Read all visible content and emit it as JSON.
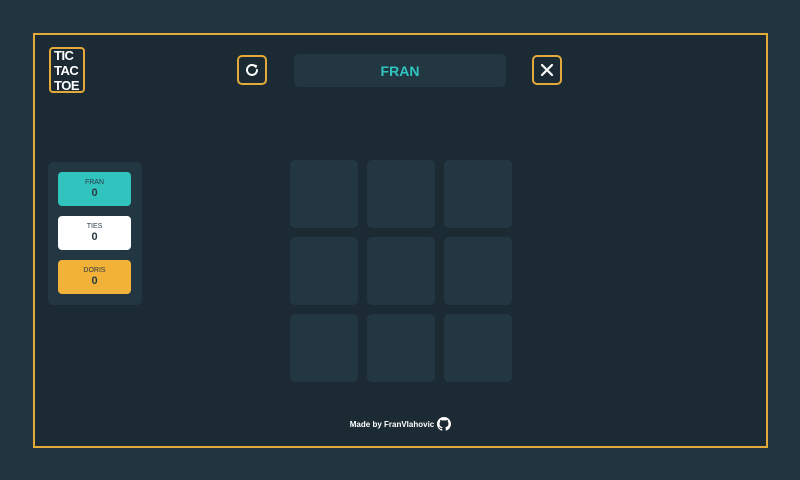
{
  "logo": {
    "line1": "TIC",
    "line2": "TAC",
    "line3": "TOE",
    "icon": "tic-tac-toe-logo"
  },
  "header": {
    "restart_icon": "restart-icon",
    "close_icon": "close-icon",
    "current_turn": "FRAN"
  },
  "scoreboard": [
    {
      "name": "FRAN",
      "score": "0",
      "color": "#31c3bd"
    },
    {
      "name": "TIES",
      "score": "0",
      "color": "#ffffff"
    },
    {
      "name": "DORIS",
      "score": "0",
      "color": "#f2b137"
    }
  ],
  "board": {
    "cells": [
      "",
      "",
      "",
      "",
      "",
      "",
      "",
      "",
      ""
    ]
  },
  "footer": {
    "credit": "Made by FranVlahovic",
    "icon": "github-icon"
  },
  "colors": {
    "background": "#213440",
    "panel": "#1b2a33",
    "tile": "#223742",
    "accent": "#e3a93a",
    "player1": "#31c3bd",
    "player2": "#f2b137"
  }
}
